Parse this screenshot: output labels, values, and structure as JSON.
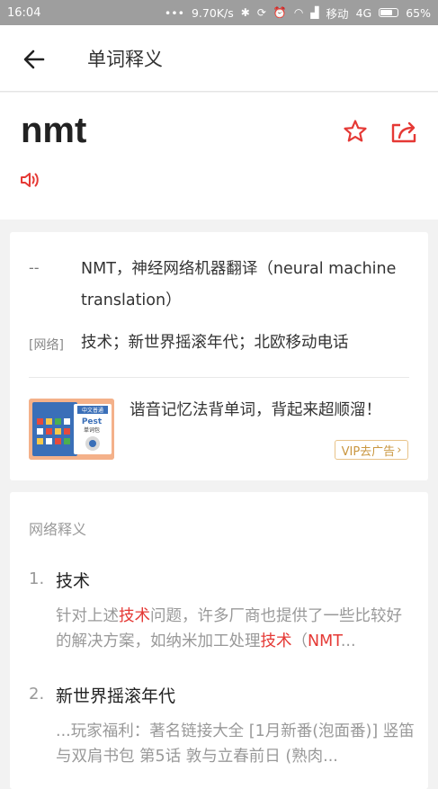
{
  "status_bar": {
    "time": "16:04",
    "dots": "•••",
    "speed": "9.70K/s",
    "carrier": "移动",
    "network": "4G",
    "battery": "65%"
  },
  "app_bar": {
    "title": "单词释义"
  },
  "word": {
    "text": "nmt"
  },
  "definitions": [
    {
      "pos": "--",
      "text": "NMT，神经网络机器翻译（neural machine translation）"
    },
    {
      "pos": "[网络]",
      "text": "技术；新世界摇滚年代；北欧移动电话"
    }
  ],
  "ad": {
    "text": "谐音记忆法背单词，背起来超顺溜！",
    "vip": "VIP去广告",
    "image_text": {
      "top": "中文普通",
      "brand": "Pest",
      "sub": "单词包"
    }
  },
  "network_section": {
    "title": "网络释义",
    "entries": [
      {
        "num": "1.",
        "term": "技术",
        "body": [
          {
            "t": "针对上述",
            "hl": false
          },
          {
            "t": "技术",
            "hl": true
          },
          {
            "t": "问题，许多厂商也提供了一些比较好的解决方案，如纳米加工处理",
            "hl": false
          },
          {
            "t": "技术",
            "hl": true
          },
          {
            "t": "（",
            "hl": false
          },
          {
            "t": "NMT",
            "hl": true
          },
          {
            "t": "...",
            "hl": false
          }
        ]
      },
      {
        "num": "2.",
        "term": "新世界摇滚年代",
        "body": [
          {
            "t": "...玩家福利：著名链接大全 [1月新番(泡面番)] 竖笛与双肩书包 第5话 敦与立春前日 (熟肉...",
            "hl": false
          }
        ]
      }
    ]
  },
  "colors": {
    "accent": "#e53935",
    "status_bar": "#9e9e9e",
    "vip": "#c9963f"
  }
}
